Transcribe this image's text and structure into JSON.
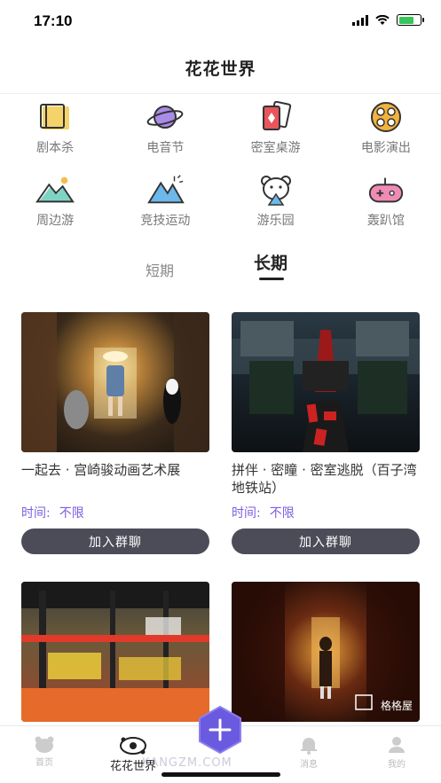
{
  "status": {
    "time": "17:10",
    "battery_percent": 70
  },
  "nav": {
    "title": "花花世界"
  },
  "categories": [
    {
      "label": "剧本杀",
      "icon": "book-icon"
    },
    {
      "label": "电音节",
      "icon": "planet-icon"
    },
    {
      "label": "密室桌游",
      "icon": "cards-icon"
    },
    {
      "label": "电影演出",
      "icon": "film-reel-icon"
    },
    {
      "label": "周边游",
      "icon": "landscape-icon"
    },
    {
      "label": "竞技运动",
      "icon": "mountain-flag-icon"
    },
    {
      "label": "游乐园",
      "icon": "bear-icon"
    },
    {
      "label": "轰趴馆",
      "icon": "gamepad-icon"
    }
  ],
  "tabs": {
    "short": "短期",
    "long": "长期"
  },
  "cards": [
    {
      "title": "一起去 · 宫崎骏动画艺术展",
      "time_label": "时间:",
      "time_value": "不限",
      "button": "加入群聊"
    },
    {
      "title": "拼伴 · 密瞳 · 密室逃脱（百子湾地铁站）",
      "time_label": "时间:",
      "time_value": "不限",
      "button": "加入群聊"
    },
    {
      "title": "",
      "time_label": "",
      "time_value": "",
      "button": ""
    },
    {
      "title": "",
      "time_label": "",
      "time_value": "",
      "button": "",
      "logo_text": "格格屋"
    }
  ],
  "tabbar": {
    "home": "首页",
    "world": "花花世界",
    "messages": "消息",
    "mine": "我的",
    "watermark": "KANGZM.COM"
  },
  "colors": {
    "accent": "#7b5ee0",
    "button": "#4c4c59",
    "fab": "#6a5ae0"
  }
}
